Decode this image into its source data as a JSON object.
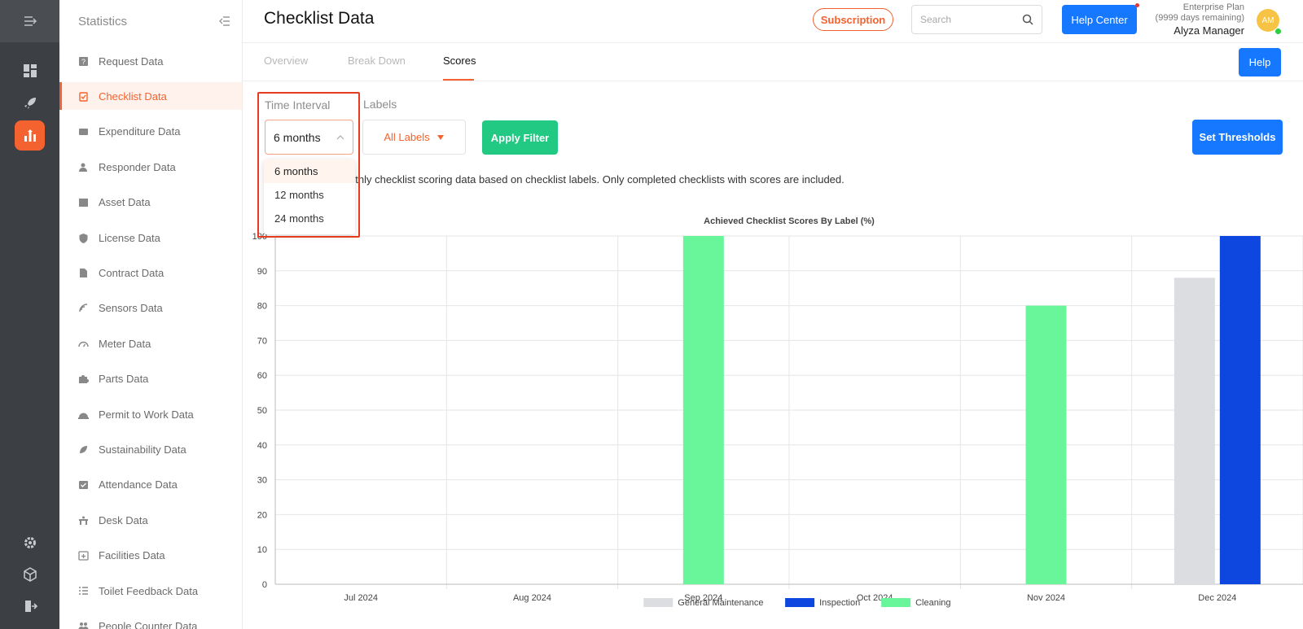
{
  "sidebar": {
    "title": "Statistics",
    "items": [
      {
        "label": "Request Data",
        "icon": "question-icon"
      },
      {
        "label": "Checklist Data",
        "icon": "clipboard-check-icon",
        "active": true
      },
      {
        "label": "Expenditure Data",
        "icon": "wallet-icon"
      },
      {
        "label": "Responder Data",
        "icon": "person-icon"
      },
      {
        "label": "Asset Data",
        "icon": "box-icon"
      },
      {
        "label": "License Data",
        "icon": "shield-icon"
      },
      {
        "label": "Contract Data",
        "icon": "document-icon"
      },
      {
        "label": "Sensors Data",
        "icon": "signal-icon"
      },
      {
        "label": "Meter Data",
        "icon": "gauge-icon"
      },
      {
        "label": "Parts Data",
        "icon": "puzzle-icon"
      },
      {
        "label": "Permit to Work Data",
        "icon": "helmet-icon"
      },
      {
        "label": "Sustainability Data",
        "icon": "leaf-icon"
      },
      {
        "label": "Attendance Data",
        "icon": "calendar-check-icon"
      },
      {
        "label": "Desk Data",
        "icon": "desk-icon"
      },
      {
        "label": "Facilities Data",
        "icon": "calendar-plus-icon"
      },
      {
        "label": "Toilet Feedback Data",
        "icon": "list-icon"
      },
      {
        "label": "People Counter Data",
        "icon": "people-icon"
      }
    ]
  },
  "header": {
    "title": "Checklist Data",
    "subscription_label": "Subscription",
    "search_placeholder": "Search",
    "help_center_label": "Help Center",
    "plan_name": "Enterprise Plan",
    "plan_remaining": "(9999 days remaining)",
    "user_name": "Alyza Manager",
    "avatar_initials": "AM"
  },
  "tabs": [
    {
      "label": "Overview"
    },
    {
      "label": "Break Down"
    },
    {
      "label": "Scores",
      "active": true
    }
  ],
  "help_label": "Help",
  "filters": {
    "time_interval_label": "Time Interval",
    "time_interval_value": "6 months",
    "time_interval_options": [
      "6 months",
      "12 months",
      "24 months"
    ],
    "labels_label": "Labels",
    "labels_value": "All Labels",
    "apply_label": "Apply Filter",
    "thresholds_label": "Set Thresholds"
  },
  "description": "ys aggregated monthly checklist scoring data based on checklist labels. Only completed checklists with scores are included.",
  "colors": {
    "accent": "#f4622f",
    "primary": "#1677ff",
    "success": "#21c982"
  },
  "chart_data": {
    "type": "bar",
    "title": "Achieved Checklist Scores By Label (%)",
    "categories": [
      "Jul 2024",
      "Aug 2024",
      "Sep 2024",
      "Oct 2024",
      "Nov 2024",
      "Dec 2024"
    ],
    "ylim": [
      0,
      100
    ],
    "yticks": [
      0,
      10,
      20,
      30,
      40,
      50,
      60,
      70,
      80,
      90,
      100
    ],
    "grid": true,
    "legend_position": "bottom",
    "series": [
      {
        "name": "General Maintenance",
        "color": "#dcdde0",
        "values": [
          null,
          null,
          null,
          null,
          null,
          88
        ]
      },
      {
        "name": "Inspection",
        "color": "#0d47e0",
        "values": [
          null,
          null,
          null,
          null,
          null,
          100
        ]
      },
      {
        "name": "Cleaning",
        "color": "#69f59a",
        "values": [
          null,
          null,
          100,
          null,
          80,
          null
        ]
      }
    ]
  }
}
